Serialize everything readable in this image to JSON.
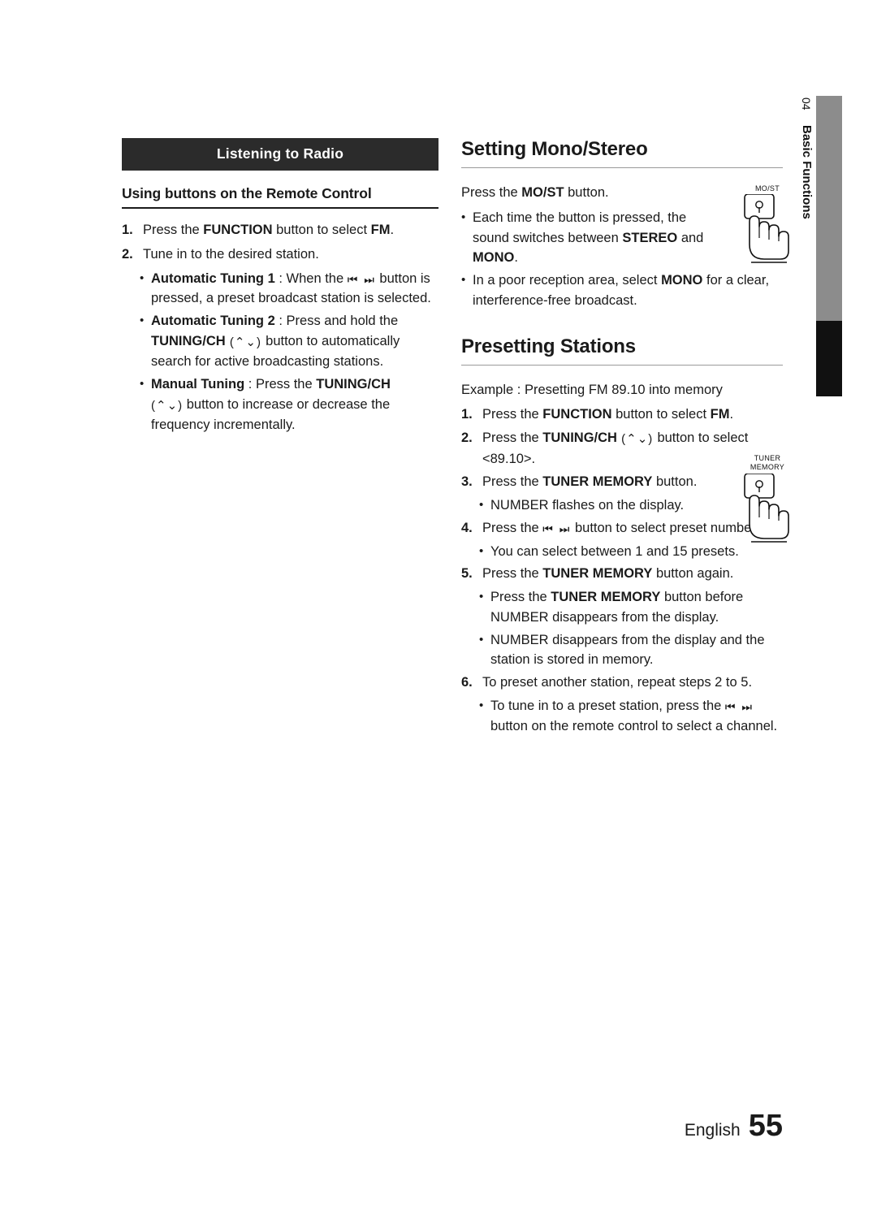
{
  "side_tab": {
    "chapter_number": "04",
    "chapter_label": "Basic Functions"
  },
  "left_column": {
    "banner": "Listening to Radio",
    "subhead": "Using buttons on the Remote Control",
    "step1_num": "1.",
    "step1_text_a": "Press the ",
    "step1_bold_function": "FUNCTION",
    "step1_text_b": " button to select ",
    "step1_bold_fm": "FM",
    "step1_text_c": ".",
    "step2_num": "2.",
    "step2_text": "Tune in to the desired station.",
    "bullet1_label": "Automatic Tuning 1",
    "bullet1_text_a": " : When the ",
    "bullet1_glyph": "⏮ ⏭",
    "bullet1_text_b": " button is pressed, a preset broadcast station is selected.",
    "bullet2_label": "Automatic Tuning 2",
    "bullet2_text_a": " : Press and hold the ",
    "bullet2_bold": "TUNING/CH",
    "bullet2_glyph": " (⌃⌄) ",
    "bullet2_text_b": "button to automatically search for active broadcasting stations.",
    "bullet3_label": "Manual Tuning",
    "bullet3_text_a": " : Press the ",
    "bullet3_bold": "TUNING/CH",
    "bullet3_glyph": "(⌃⌄)",
    "bullet3_text_b": " button to increase or decrease the frequency incrementally."
  },
  "right_column": {
    "heading_mono": "Setting Mono/Stereo",
    "mono_intro_a": "Press the ",
    "mono_intro_bold": "MO/ST",
    "mono_intro_b": " button.",
    "mono_b1_a": "Each time the button is pressed, the sound switches between ",
    "mono_b1_bold1": "STEREO",
    "mono_b1_b": " and ",
    "mono_b1_bold2": "MONO",
    "mono_b1_c": ".",
    "mono_b2_a": "In a poor reception area, select ",
    "mono_b2_bold": "MONO",
    "mono_b2_b": " for a clear, interference-free broadcast.",
    "heading_preset": "Presetting Stations",
    "example": "Example : Presetting FM 89.10 into memory",
    "p1_num": "1.",
    "p1_a": "Press the ",
    "p1_bold1": "FUNCTION",
    "p1_b": " button to select ",
    "p1_bold2": "FM",
    "p1_c": ".",
    "p2_num": "2.",
    "p2_a": "Press the ",
    "p2_bold": "TUNING/CH",
    "p2_glyph": " (⌃⌄) ",
    "p2_b": "button to select <89.10>.",
    "p3_num": "3.",
    "p3_a": "Press the ",
    "p3_bold": "TUNER MEMORY",
    "p3_b": " button.",
    "p3_bullet": "NUMBER flashes on the display.",
    "p4_num": "4.",
    "p4_a": "Press the ",
    "p4_glyph": "⏮  ⏭",
    "p4_b": " button to select preset number.",
    "p4_bullet": "You can select between 1 and 15 presets.",
    "p5_num": "5.",
    "p5_a": "Press the ",
    "p5_bold": "TUNER MEMORY",
    "p5_b": " button again.",
    "p5_bullet1_a": "Press the ",
    "p5_bullet1_bold": "TUNER MEMORY",
    "p5_bullet1_b": " button before NUMBER disappears from the display.",
    "p5_bullet2": "NUMBER disappears from the display and the station is stored in memory.",
    "p6_num": "6.",
    "p6_text": "To preset another station, repeat steps 2 to 5.",
    "p6_bullet_a": "To tune in to a preset station, press the ",
    "p6_bullet_glyph": "⏮ ⏭",
    "p6_bullet_b": " button on the remote control to select a channel."
  },
  "illustrations": {
    "most_button_label": "MO/ST",
    "tuner_button_label_line1": "TUNER",
    "tuner_button_label_line2": "MEMORY"
  },
  "footer": {
    "language": "English",
    "page_number": "55"
  }
}
